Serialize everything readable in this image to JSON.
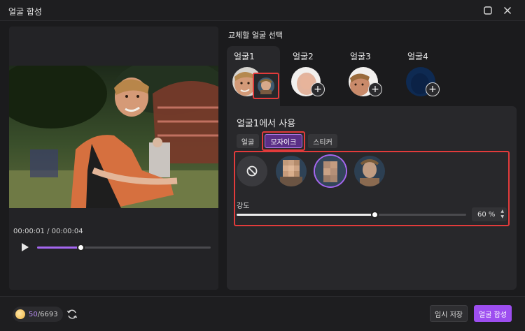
{
  "window": {
    "title": "얼굴 합성"
  },
  "player": {
    "time_display": "00:00:01 / 00:00:04",
    "progress_fraction": 0.25
  },
  "panel": {
    "section_title": "교체할 얼굴 선택",
    "face_tabs": [
      {
        "label": "얼굴1"
      },
      {
        "label": "얼굴2"
      },
      {
        "label": "얼굴3"
      },
      {
        "label": "얼굴4"
      }
    ],
    "apply_title": "얼굴1에서 사용",
    "type_tabs": [
      {
        "label": "얼굴"
      },
      {
        "label": "모자이크"
      },
      {
        "label": "스티커"
      }
    ],
    "strength_label": "강도",
    "strength_value": "60",
    "strength_unit": "%"
  },
  "footer": {
    "credits_used": "50",
    "credits_total": "/6693",
    "temp_save_label": "임시 저장",
    "merge_label": "얼굴 합성"
  },
  "colors": {
    "accent": "#9d4ef0",
    "highlight_box": "#e23b3b",
    "background": "#1b1b1d"
  },
  "icons": [
    "maximize-icon",
    "close-icon",
    "play-icon",
    "plus-icon",
    "none-icon",
    "coin-icon",
    "refresh-icon",
    "spinner-arrows-icon"
  ]
}
